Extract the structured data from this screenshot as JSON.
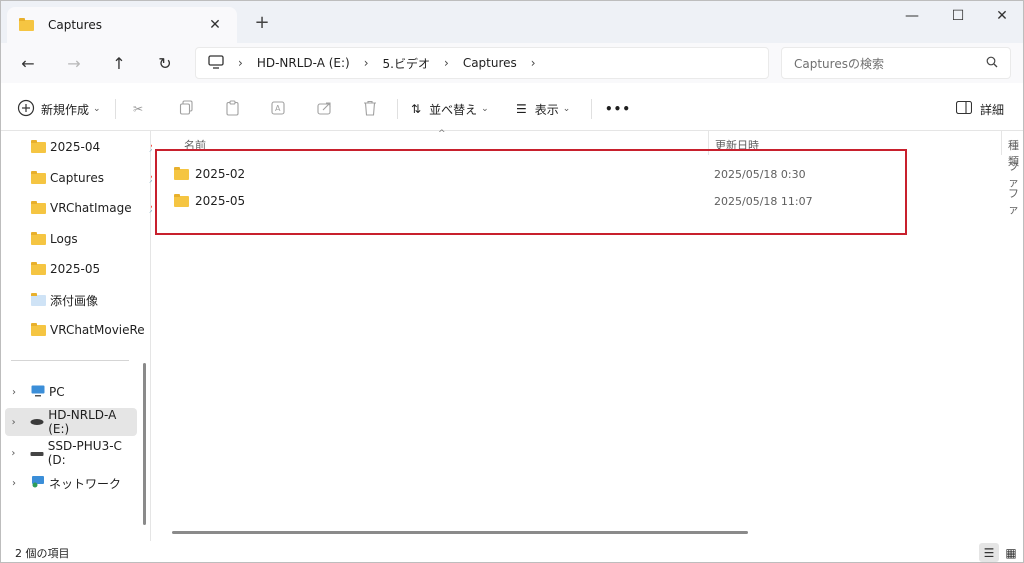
{
  "window": {
    "tab_title": "Captures",
    "tab_close": "✕",
    "new_tab": "+",
    "minimize": "—",
    "maximize": "☐",
    "close": "✕"
  },
  "nav": {
    "back": "←",
    "forward": "→",
    "up": "↑",
    "refresh": "↻",
    "breadcrumbs": [
      "HD-NRLD-A (E:)",
      "5.ビデオ",
      "Captures"
    ],
    "search_placeholder": "Capturesの検索"
  },
  "command_bar": {
    "new_label": "新規作成",
    "sort_label": "並べ替え",
    "view_label": "表示",
    "more_label": "•••",
    "details_label": "詳細"
  },
  "sidebar": {
    "quick_access": [
      {
        "label": "2025-04",
        "pinned": true
      },
      {
        "label": "Captures",
        "pinned": true
      },
      {
        "label": "VRChatImage",
        "pinned": true
      },
      {
        "label": "Logs",
        "pinned": false
      },
      {
        "label": "2025-05",
        "pinned": false
      },
      {
        "label": "添付画像",
        "pinned": false
      },
      {
        "label": "VRChatMovieRe",
        "pinned": false
      }
    ],
    "devices": [
      {
        "label": "PC",
        "icon": "pc-icon",
        "selected": false
      },
      {
        "label": "HD-NRLD-A (E:)",
        "icon": "drive-icon",
        "selected": true
      },
      {
        "label": "SSD-PHU3-C (D:",
        "icon": "drive-icon",
        "selected": false
      },
      {
        "label": "ネットワーク",
        "icon": "network-icon",
        "selected": false
      }
    ]
  },
  "content": {
    "columns": [
      "名前",
      "更新日時",
      "種類"
    ],
    "rows": [
      {
        "name": "2025-02",
        "modified": "2025/05/18 0:30",
        "type": "ファ"
      },
      {
        "name": "2025-05",
        "modified": "2025/05/18 11:07",
        "type": "ファ"
      }
    ]
  },
  "status": {
    "item_count": "2 個の項目"
  }
}
